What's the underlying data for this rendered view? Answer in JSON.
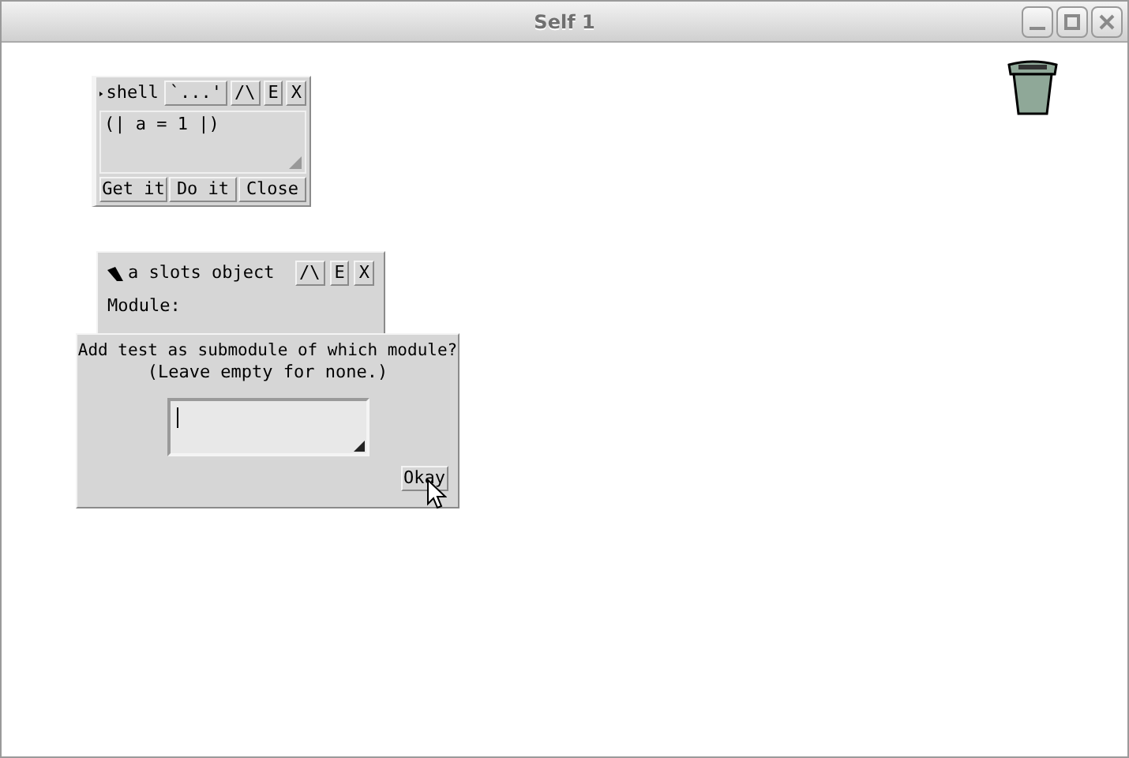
{
  "window": {
    "title": "Self 1"
  },
  "shell": {
    "title": "shell",
    "buttons": [
      "`...'",
      "/\\",
      "E",
      "X"
    ],
    "code": "(| a = 1 |)",
    "actions": [
      "Get it",
      "Do it",
      "Close"
    ]
  },
  "slots_object": {
    "title": "a slots object",
    "buttons": [
      "/\\",
      "E",
      "X"
    ],
    "label": "Module:"
  },
  "dialog": {
    "prompt": "Add test as submodule of which module?",
    "hint": "(Leave empty for none.)",
    "button": "Okay"
  }
}
